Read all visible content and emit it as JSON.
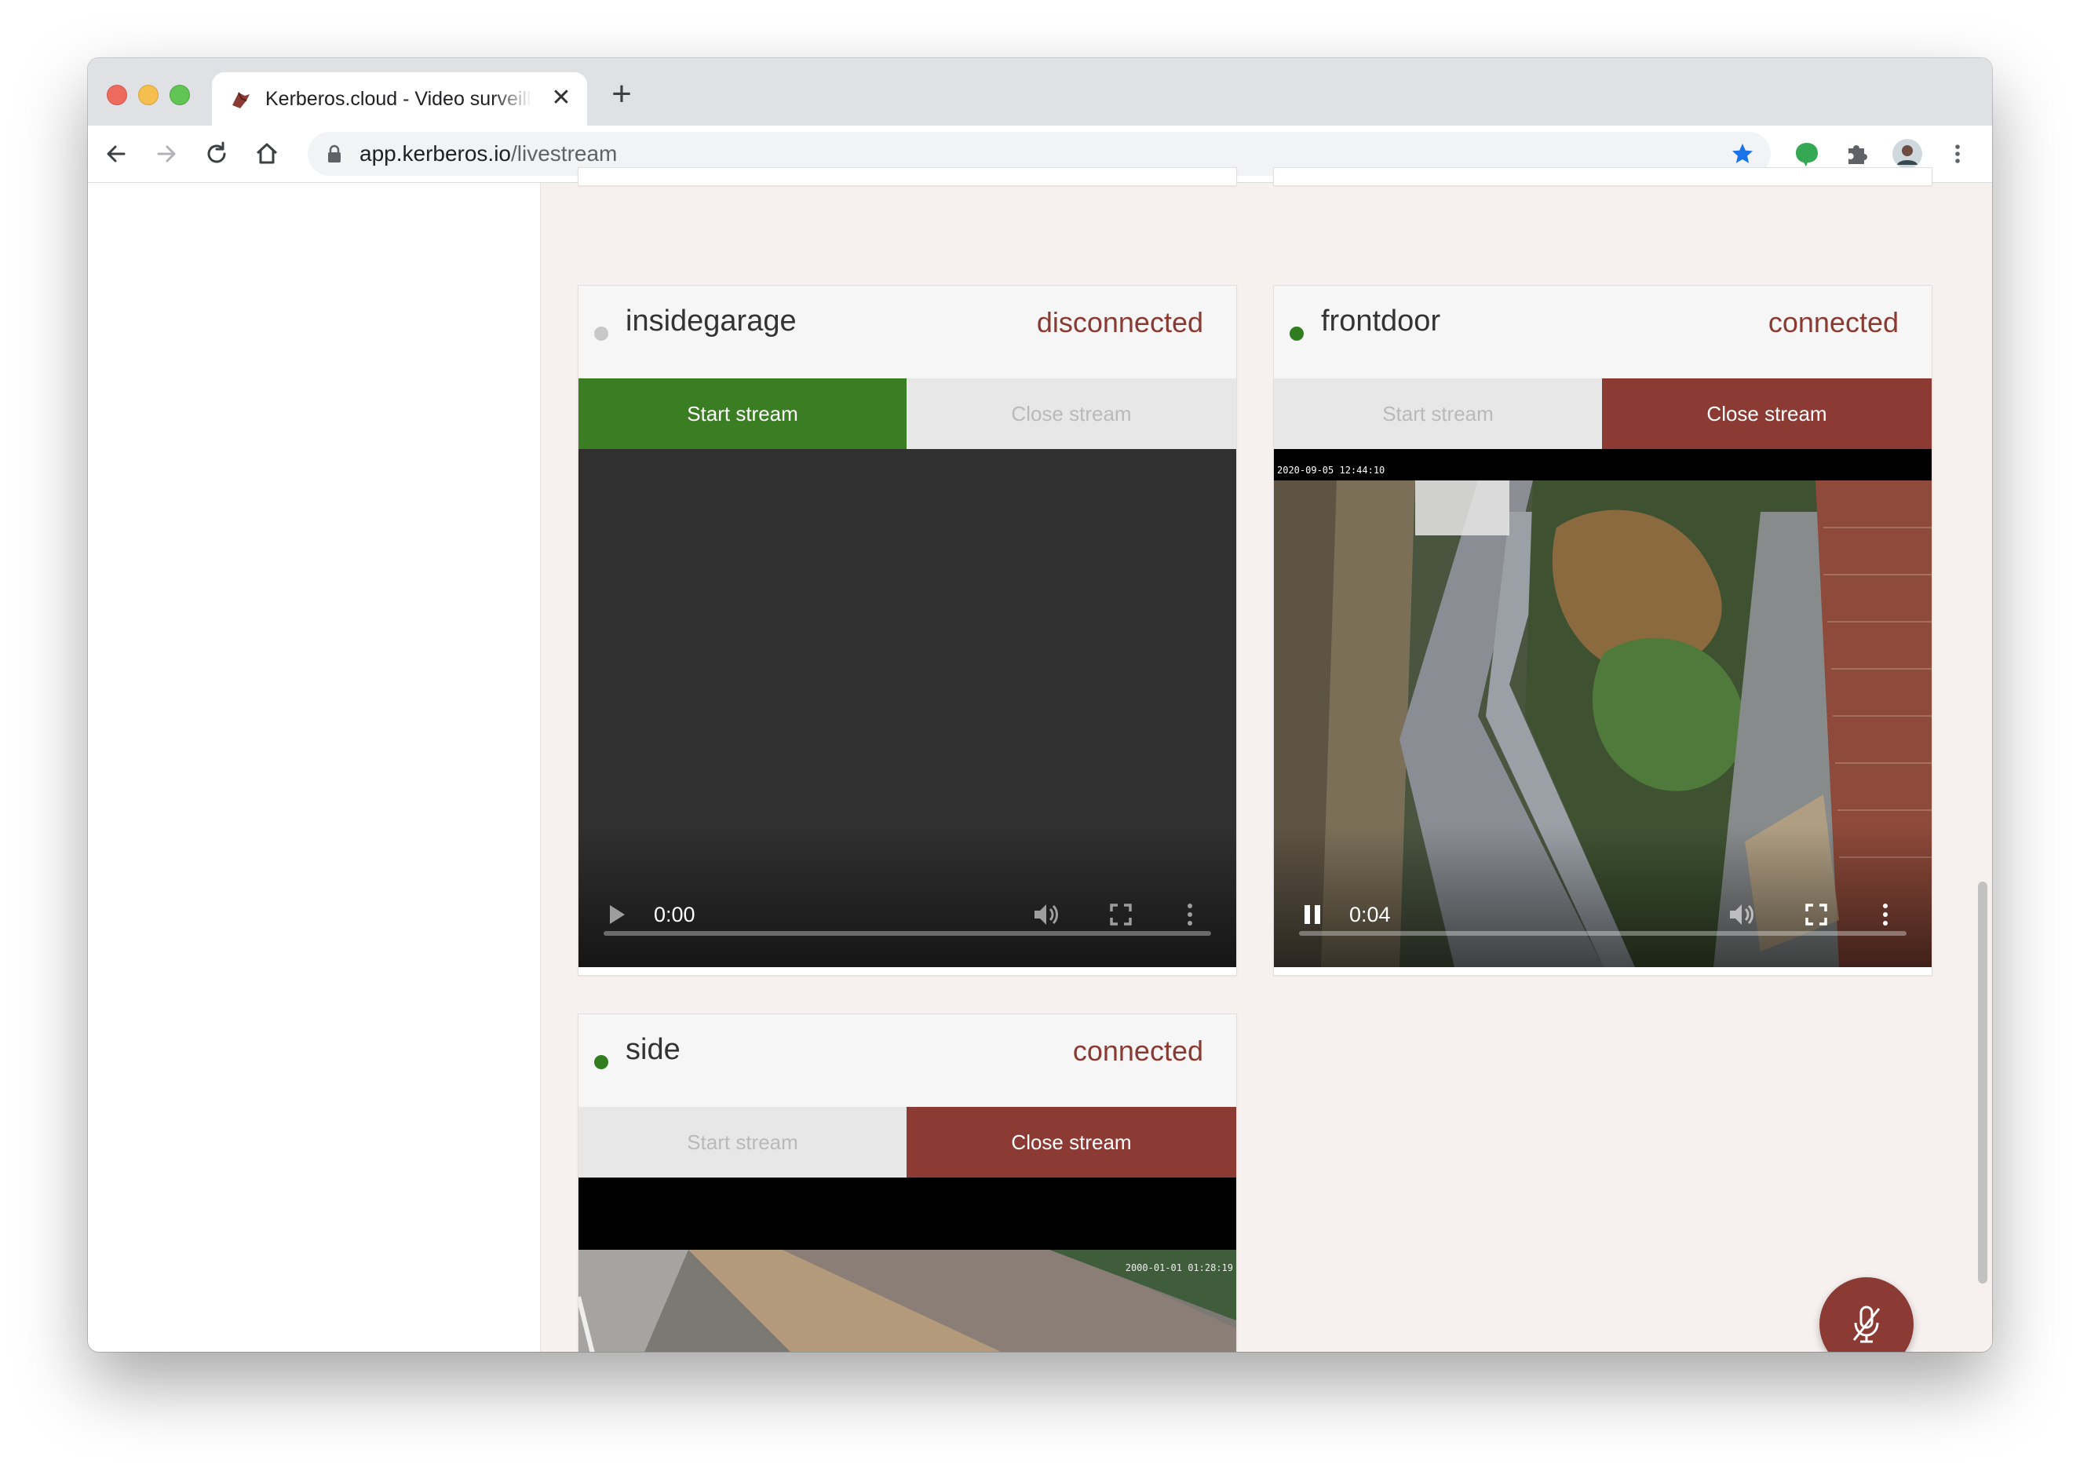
{
  "browser": {
    "tab_title": "Kerberos.cloud - Video surveillance",
    "new_tab_label": "+",
    "close_tab_label": "✕",
    "url_domain": "app.kerberos.io",
    "url_path": "/livestream"
  },
  "cameras": [
    {
      "name": "insidegarage",
      "status": "disconnected",
      "status_color": "#c8c8c8",
      "start_label": "Start stream",
      "close_label": "Close stream",
      "start_enabled": true,
      "close_enabled": false,
      "time": "0:00",
      "playing": false
    },
    {
      "name": "frontdoor",
      "status": "connected",
      "status_color": "#2f7d1f",
      "start_label": "Start stream",
      "close_label": "Close stream",
      "start_enabled": false,
      "close_enabled": true,
      "time": "0:04",
      "playing": true,
      "overlay_timestamp": "2020-09-05 12:44:10"
    },
    {
      "name": "side",
      "status": "connected",
      "status_color": "#2f7d1f",
      "start_label": "Start stream",
      "close_label": "Close stream",
      "start_enabled": false,
      "close_enabled": true,
      "overlay_timestamp": "2000-01-01 01:28:19"
    }
  ],
  "colors": {
    "start_active": "#3a7d22",
    "close_active": "#8b3a34",
    "status_text": "#8b3a32",
    "page_background": "#f6f0ef"
  },
  "icons": {
    "back": "back-arrow-icon",
    "forward": "forward-arrow-icon",
    "reload": "reload-icon",
    "home": "home-icon",
    "lock": "lock-icon",
    "bookmark": "star-icon",
    "extension_green": "green-extension-icon",
    "extensions": "puzzle-icon",
    "profile": "profile-avatar",
    "menu": "kebab-menu-icon",
    "fab": "microphone-muted-icon"
  }
}
